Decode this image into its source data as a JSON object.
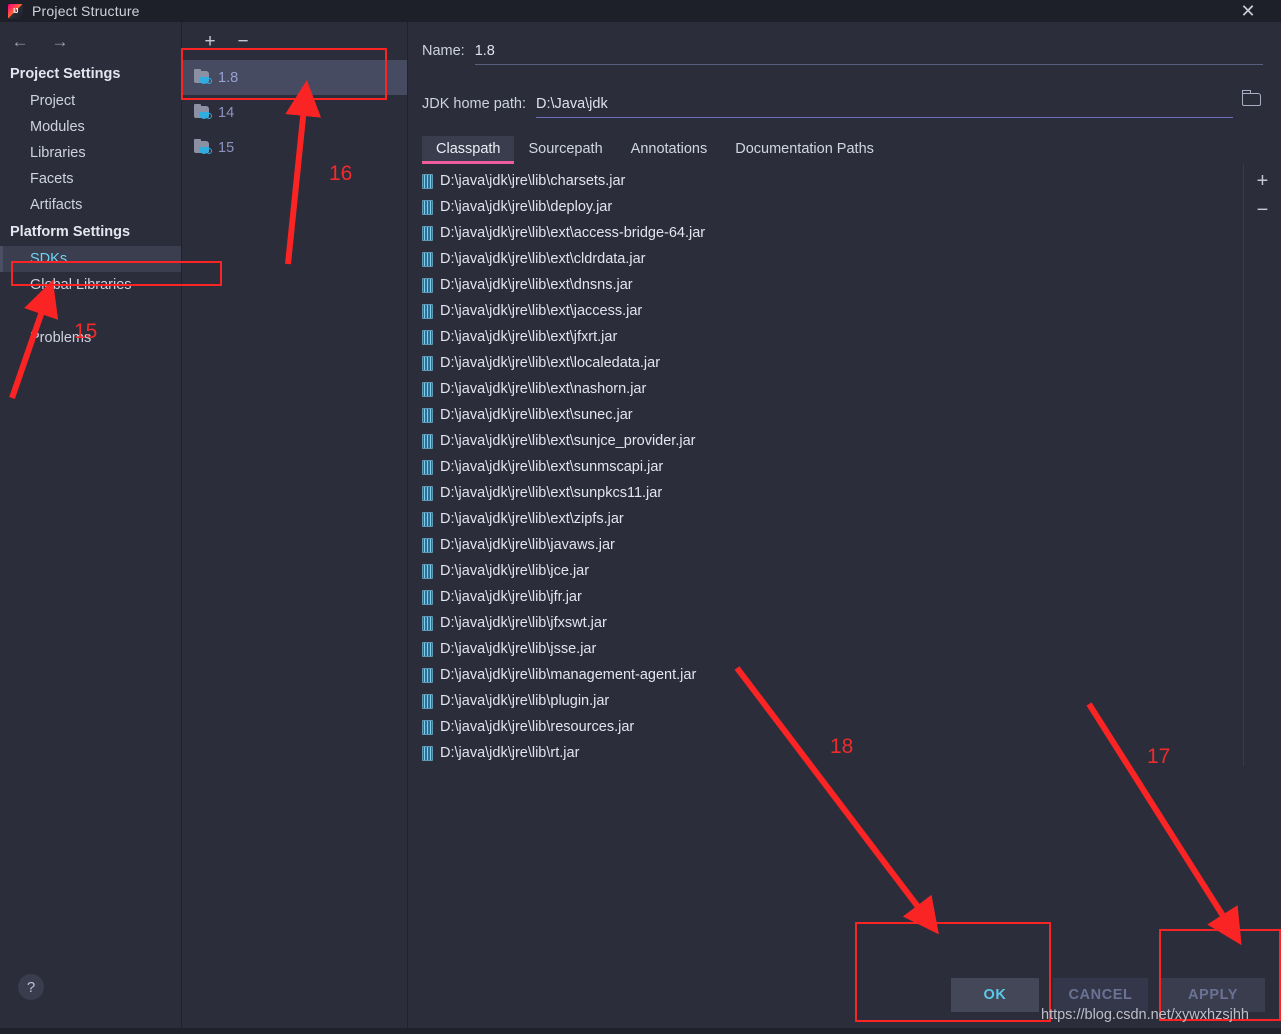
{
  "window": {
    "title": "Project Structure",
    "logo_icon": "intellij-idea-logo",
    "close_icon": "close-icon"
  },
  "nav": {
    "back_icon": "arrow-left-icon",
    "forward_icon": "arrow-right-icon"
  },
  "sidebar": {
    "groups": [
      {
        "title": "Project Settings",
        "items": [
          {
            "label": "Project",
            "selected": false
          },
          {
            "label": "Modules",
            "selected": false
          },
          {
            "label": "Libraries",
            "selected": false
          },
          {
            "label": "Facets",
            "selected": false
          },
          {
            "label": "Artifacts",
            "selected": false
          }
        ]
      },
      {
        "title": "Platform Settings",
        "items": [
          {
            "label": "SDKs",
            "selected": true
          },
          {
            "label": "Global Libraries",
            "selected": false
          },
          {
            "label": "Problems",
            "selected": false
          }
        ]
      }
    ]
  },
  "sdk_list": {
    "add_icon": "plus-icon",
    "remove_icon": "minus-icon",
    "items": [
      {
        "label": "1.8",
        "icon": "jdk-folder-icon",
        "selected": true
      },
      {
        "label": "14",
        "icon": "jdk-folder-icon",
        "selected": false
      },
      {
        "label": "15",
        "icon": "jdk-folder-icon",
        "selected": false
      }
    ]
  },
  "detail": {
    "name_label": "Name:",
    "name_value": "1.8",
    "jdk_home_label": "JDK home path:",
    "jdk_home_value": "D:\\Java\\jdk",
    "browse_icon": "folder-browse-icon",
    "tabs": [
      {
        "label": "Classpath",
        "active": true
      },
      {
        "label": "Sourcepath",
        "active": false
      },
      {
        "label": "Annotations",
        "active": false
      },
      {
        "label": "Documentation Paths",
        "active": false
      }
    ],
    "tab_accent_color": "#f05d9e",
    "classpath_add_icon": "plus-icon",
    "classpath_remove_icon": "minus-icon",
    "classpath": [
      "D:\\java\\jdk\\jre\\lib\\charsets.jar",
      "D:\\java\\jdk\\jre\\lib\\deploy.jar",
      "D:\\java\\jdk\\jre\\lib\\ext\\access-bridge-64.jar",
      "D:\\java\\jdk\\jre\\lib\\ext\\cldrdata.jar",
      "D:\\java\\jdk\\jre\\lib\\ext\\dnsns.jar",
      "D:\\java\\jdk\\jre\\lib\\ext\\jaccess.jar",
      "D:\\java\\jdk\\jre\\lib\\ext\\jfxrt.jar",
      "D:\\java\\jdk\\jre\\lib\\ext\\localedata.jar",
      "D:\\java\\jdk\\jre\\lib\\ext\\nashorn.jar",
      "D:\\java\\jdk\\jre\\lib\\ext\\sunec.jar",
      "D:\\java\\jdk\\jre\\lib\\ext\\sunjce_provider.jar",
      "D:\\java\\jdk\\jre\\lib\\ext\\sunmscapi.jar",
      "D:\\java\\jdk\\jre\\lib\\ext\\sunpkcs11.jar",
      "D:\\java\\jdk\\jre\\lib\\ext\\zipfs.jar",
      "D:\\java\\jdk\\jre\\lib\\javaws.jar",
      "D:\\java\\jdk\\jre\\lib\\jce.jar",
      "D:\\java\\jdk\\jre\\lib\\jfr.jar",
      "D:\\java\\jdk\\jre\\lib\\jfxswt.jar",
      "D:\\java\\jdk\\jre\\lib\\jsse.jar",
      "D:\\java\\jdk\\jre\\lib\\management-agent.jar",
      "D:\\java\\jdk\\jre\\lib\\plugin.jar",
      "D:\\java\\jdk\\jre\\lib\\resources.jar",
      "D:\\java\\jdk\\jre\\lib\\rt.jar"
    ]
  },
  "footer": {
    "help_icon": "question-mark-icon",
    "ok_label": "OK",
    "cancel_label": "CANCEL",
    "apply_label": "APPLY"
  },
  "annotations": {
    "color": "#fb2424",
    "numbers": [
      {
        "text": "16"
      },
      {
        "text": "15"
      },
      {
        "text": "18"
      },
      {
        "text": "17"
      }
    ]
  },
  "watermark": "https://blog.csdn.net/xywxhzsjhh"
}
